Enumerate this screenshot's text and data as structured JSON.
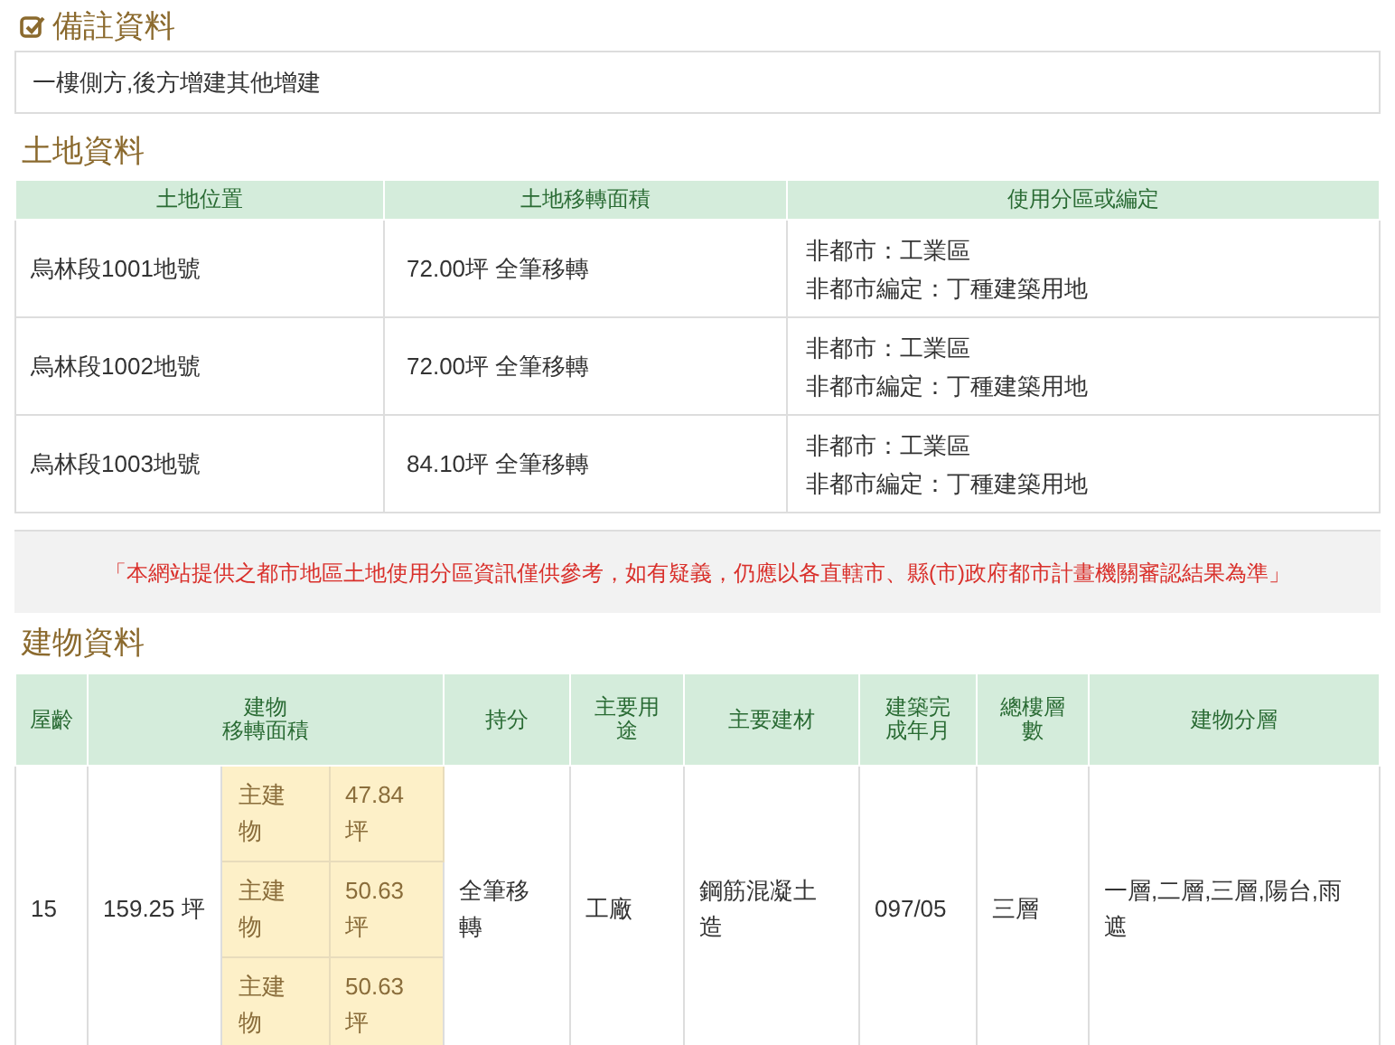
{
  "notes": {
    "title": "備註資料",
    "checked": true,
    "text": "一樓側方,後方增建其他增建"
  },
  "land": {
    "title": "土地資料",
    "columns": [
      "土地位置",
      "土地移轉面積",
      "使用分區或編定"
    ],
    "rows": [
      {
        "location": "烏林段1001地號",
        "area": "72.00坪 全筆移轉",
        "zoning": [
          "非都市：工業區",
          "非都市編定：丁種建築用地"
        ]
      },
      {
        "location": "烏林段1002地號",
        "area": "72.00坪 全筆移轉",
        "zoning": [
          "非都市：工業區",
          "非都市編定：丁種建築用地"
        ]
      },
      {
        "location": "烏林段1003地號",
        "area": "84.10坪 全筆移轉",
        "zoning": [
          "非都市：工業區",
          "非都市編定：丁種建築用地"
        ]
      }
    ]
  },
  "disclaimer": "「本網站提供之都市地區土地使用分區資訊僅供參考，如有疑義，仍應以各直轄市、縣(市)政府都市計畫機關審認結果為準」",
  "building": {
    "title": "建物資料",
    "columns": [
      "屋齡",
      "建物移轉面積",
      "持分",
      "主要用途",
      "主要建材",
      "建築完成年月",
      "總樓層數",
      "建物分層"
    ],
    "row": {
      "age": "15",
      "total_area": "159.25 坪",
      "parts": [
        {
          "label": "主建物",
          "area": "47.84 坪"
        },
        {
          "label": "主建物",
          "area": "50.63 坪"
        },
        {
          "label": "主建物",
          "area": "50.63 坪"
        }
      ],
      "share": "全筆移轉",
      "use": "工廠",
      "material": "鋼筋混凝土造",
      "completed": "097/05",
      "floors": "三層",
      "layers": "一層,二層,三層,陽台,雨遮"
    }
  }
}
